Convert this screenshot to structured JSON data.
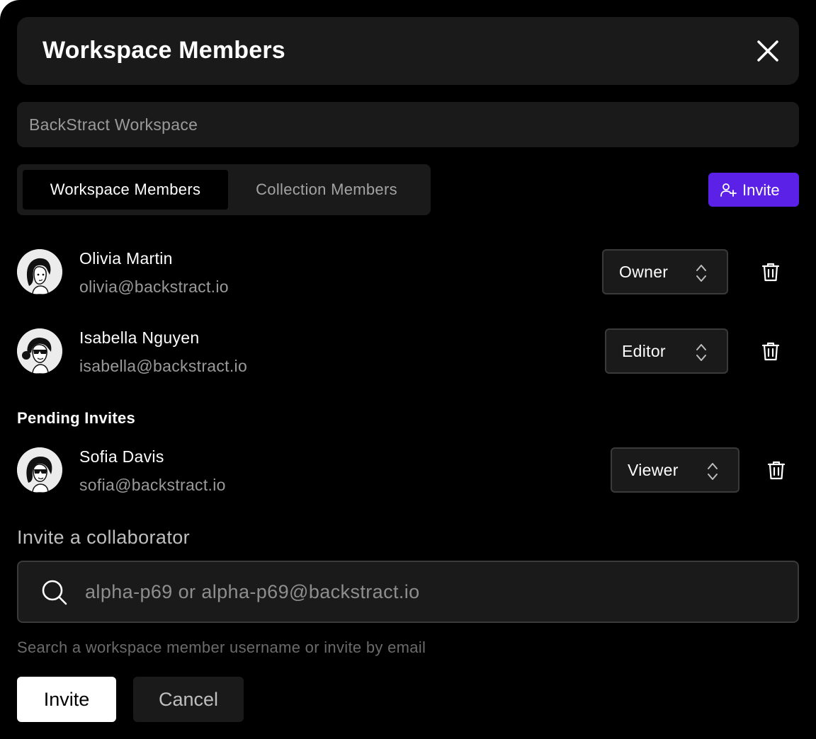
{
  "dialog": {
    "title": "Workspace Members",
    "workspace_name": "BackStract Workspace"
  },
  "tabs": [
    {
      "label": "Workspace Members",
      "active": true
    },
    {
      "label": "Collection Members",
      "active": false
    }
  ],
  "invite_button_label": "Invite",
  "members": [
    {
      "name": "Olivia Martin",
      "email": "olivia@backstract.io",
      "role": "Owner"
    },
    {
      "name": "Isabella Nguyen",
      "email": "isabella@backstract.io",
      "role": "Editor"
    }
  ],
  "pending": {
    "title": "Pending Invites",
    "items": [
      {
        "name": "Sofia Davis",
        "email": "sofia@backstract.io",
        "role": "Viewer"
      }
    ]
  },
  "invite_form": {
    "title": "Invite a collaborator",
    "placeholder": "alpha-p69 or alpha-p69@backstract.io",
    "value": "",
    "helper": "Search a workspace member username or invite by email",
    "submit_label": "Invite",
    "cancel_label": "Cancel"
  },
  "colors": {
    "background": "#000000",
    "surface": "#1a1a1a",
    "accent": "#5b21e6",
    "muted_text": "#9a9a9a"
  },
  "icons": {
    "close": "close-icon",
    "invite": "user-plus-icon",
    "role_selector": "chevron-up-down-icon",
    "delete": "trash-icon",
    "search": "search-icon"
  }
}
